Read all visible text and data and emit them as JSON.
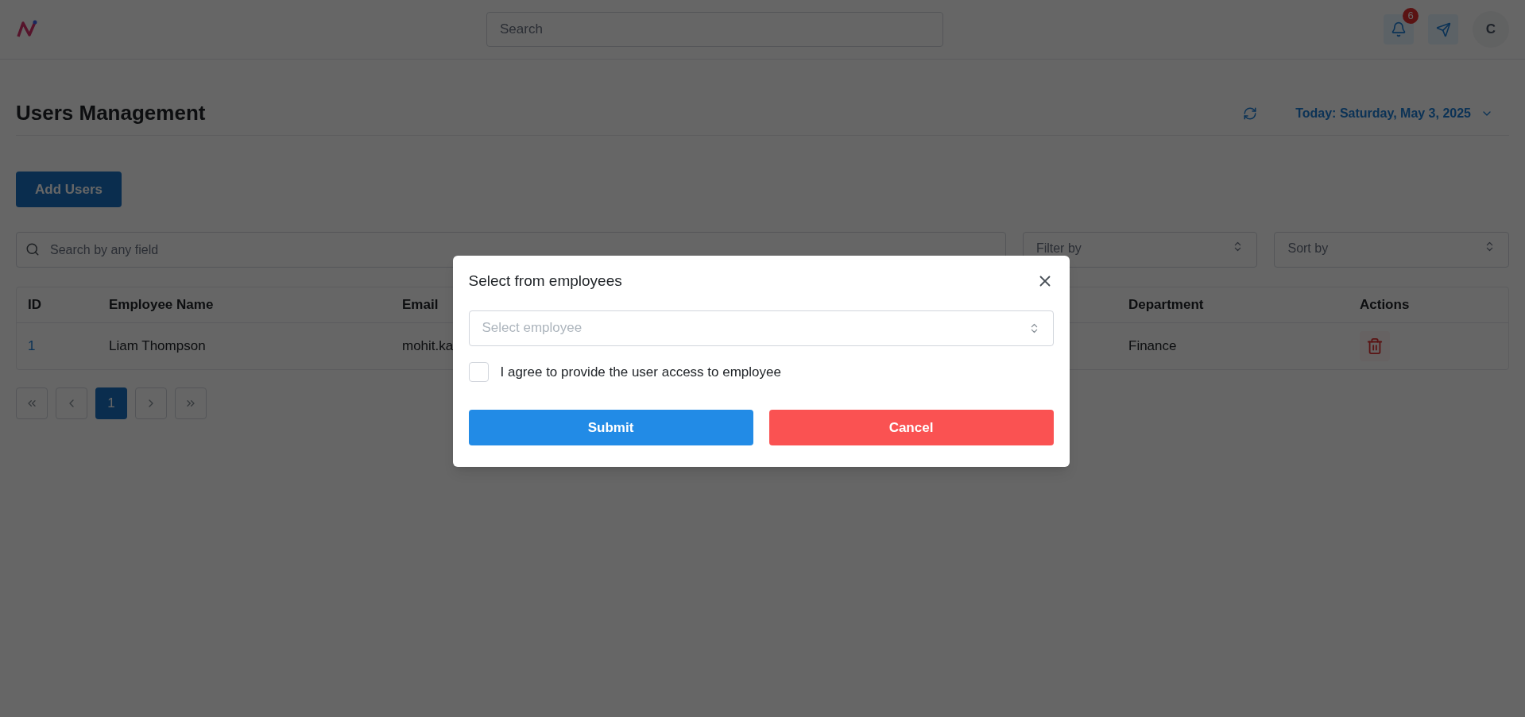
{
  "header": {
    "search": {
      "placeholder": "Search"
    },
    "notifications": {
      "count": "6"
    },
    "avatar": {
      "initial": "C"
    }
  },
  "page": {
    "title": "Users Management",
    "date": "Today: Saturday, May 3, 2025"
  },
  "add_button": "Add Users",
  "filters": {
    "search": {
      "placeholder": "Search by any field"
    },
    "filter": {
      "placeholder": "Filter by"
    },
    "sort": {
      "placeholder": "Sort by"
    }
  },
  "table": {
    "columns": [
      "ID",
      "Employee Name",
      "Email",
      "Department",
      "Actions"
    ],
    "rows": [
      {
        "id": "1",
        "name": "Liam Thompson",
        "email": "mohit.ka",
        "department": "Finance"
      }
    ]
  },
  "pagination": {
    "pages": [
      {
        "label": "1",
        "selected": true
      }
    ]
  },
  "dialog": {
    "title": "Select from employees",
    "select": {
      "placeholder": "Select employee"
    },
    "agree": {
      "label": "I agree to provide the user access to employee",
      "checked": false
    },
    "buttons": [
      {
        "label": "Submit",
        "kind": "primary"
      },
      {
        "label": "Cancel",
        "kind": "danger"
      }
    ]
  }
}
